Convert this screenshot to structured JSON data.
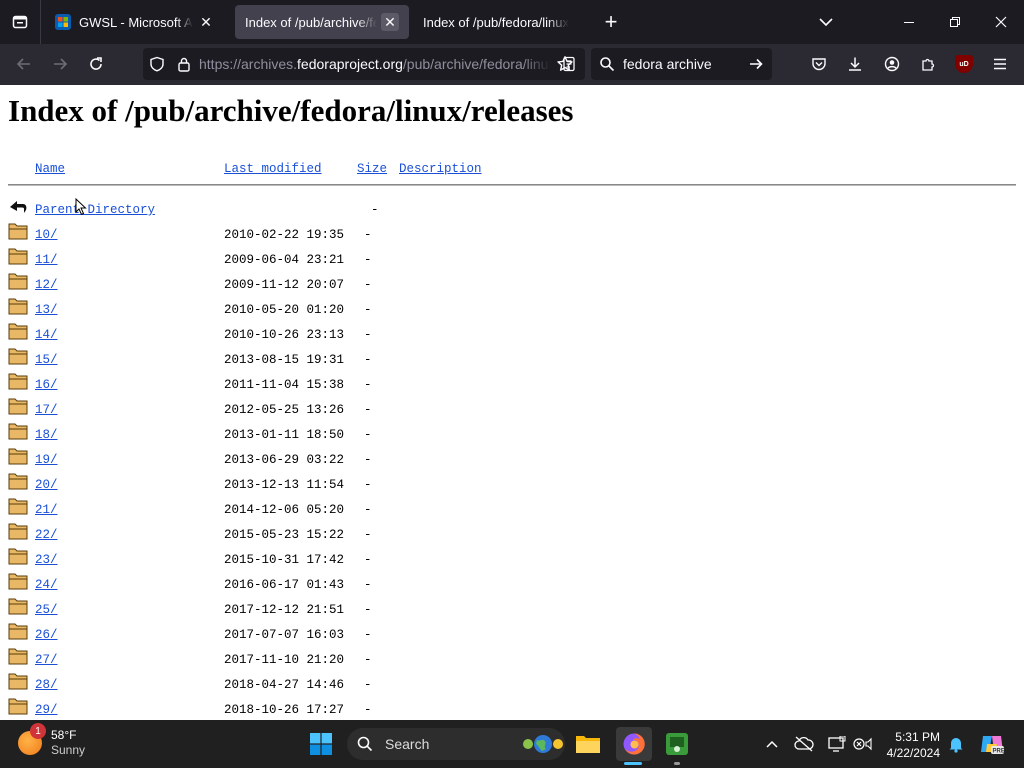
{
  "browser": {
    "tabs": [
      {
        "title": "GWSL - Microsoft Apps",
        "active": false
      },
      {
        "title": "Index of /pub/archive/fedora/linux/releases",
        "active": true
      },
      {
        "title": "Index of /pub/fedora/linux/releases",
        "active": false
      }
    ],
    "url_prefix": "https://archives.",
    "url_domain": "fedoraproject.org",
    "url_path": "/pub/archive/fedora/linux/releases/",
    "search_value": "fedora archive",
    "extension_badge": "uD"
  },
  "page": {
    "title": "Index of /pub/archive/fedora/linux/releases",
    "columns": {
      "name": "Name",
      "modified": "Last modified",
      "size": "Size",
      "description": "Description"
    },
    "parent": {
      "name": "Parent Directory",
      "size": "-"
    },
    "rows": [
      {
        "name": "10/",
        "modified": "2010-02-22 19:35",
        "size": "-"
      },
      {
        "name": "11/",
        "modified": "2009-06-04 23:21",
        "size": "-"
      },
      {
        "name": "12/",
        "modified": "2009-11-12 20:07",
        "size": "-"
      },
      {
        "name": "13/",
        "modified": "2010-05-20 01:20",
        "size": "-"
      },
      {
        "name": "14/",
        "modified": "2010-10-26 23:13",
        "size": "-"
      },
      {
        "name": "15/",
        "modified": "2013-08-15 19:31",
        "size": "-"
      },
      {
        "name": "16/",
        "modified": "2011-11-04 15:38",
        "size": "-"
      },
      {
        "name": "17/",
        "modified": "2012-05-25 13:26",
        "size": "-"
      },
      {
        "name": "18/",
        "modified": "2013-01-11 18:50",
        "size": "-"
      },
      {
        "name": "19/",
        "modified": "2013-06-29 03:22",
        "size": "-"
      },
      {
        "name": "20/",
        "modified": "2013-12-13 11:54",
        "size": "-"
      },
      {
        "name": "21/",
        "modified": "2014-12-06 05:20",
        "size": "-"
      },
      {
        "name": "22/",
        "modified": "2015-05-23 15:22",
        "size": "-"
      },
      {
        "name": "23/",
        "modified": "2015-10-31 17:42",
        "size": "-"
      },
      {
        "name": "24/",
        "modified": "2016-06-17 01:43",
        "size": "-"
      },
      {
        "name": "25/",
        "modified": "2017-12-12 21:51",
        "size": "-"
      },
      {
        "name": "26/",
        "modified": "2017-07-07 16:03",
        "size": "-"
      },
      {
        "name": "27/",
        "modified": "2017-11-10 21:20",
        "size": "-"
      },
      {
        "name": "28/",
        "modified": "2018-04-27 14:46",
        "size": "-"
      },
      {
        "name": "29/",
        "modified": "2018-10-26 17:27",
        "size": "-"
      }
    ]
  },
  "taskbar": {
    "weather_temp": "58°F",
    "weather_cond": "Sunny",
    "weather_badge": "1",
    "search_label": "Search",
    "time": "5:31 PM",
    "date": "4/22/2024"
  },
  "colors": {
    "link": "#1a4fd6",
    "tab_bar": "#1c1b22",
    "nav_bar": "#2b2a33",
    "taskbar": "#202020"
  }
}
